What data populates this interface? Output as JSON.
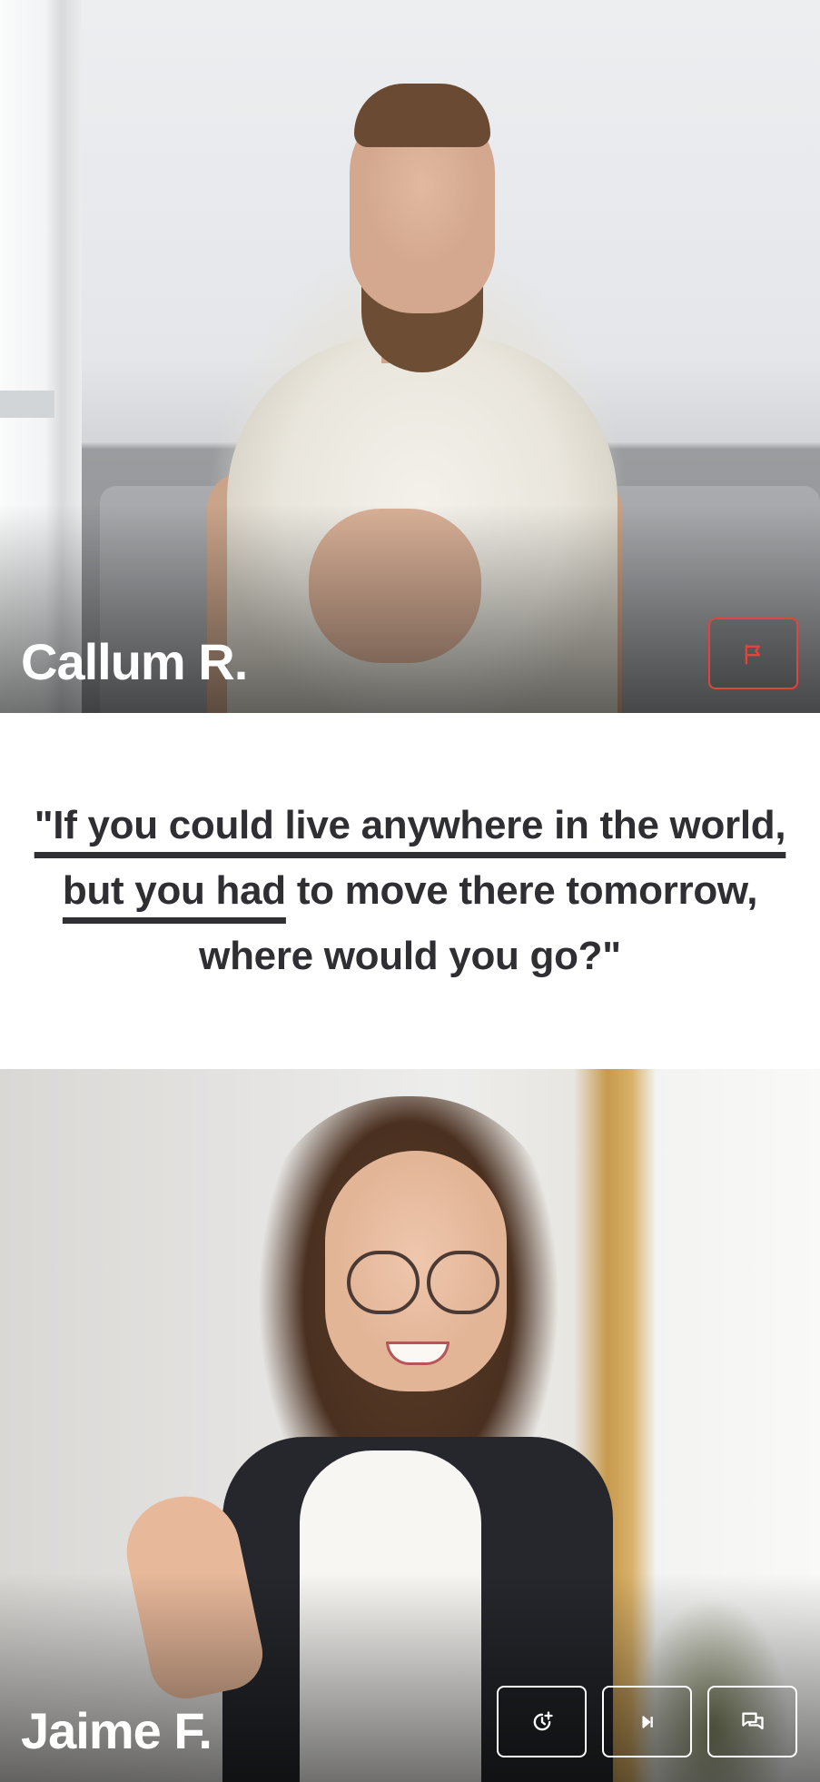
{
  "participants": {
    "top": {
      "name": "Callum R.",
      "report_icon": "flag-icon"
    },
    "bottom": {
      "name": "Jaime F."
    }
  },
  "prompt": {
    "line1": "\"If you could live anywhere in the world,",
    "line2_underlined": "but you had",
    "line2_rest": " to move there tomorrow,",
    "line3": "where would you go?\""
  },
  "controls": [
    {
      "name": "add-time",
      "icon": "timer-plus-icon"
    },
    {
      "name": "skip",
      "icon": "skip-next-icon"
    },
    {
      "name": "chat",
      "icon": "chat-icon"
    }
  ],
  "colors": {
    "report_accent": "#e0453b",
    "text_dark": "#2f2f33",
    "overlay_text": "#ffffff"
  }
}
